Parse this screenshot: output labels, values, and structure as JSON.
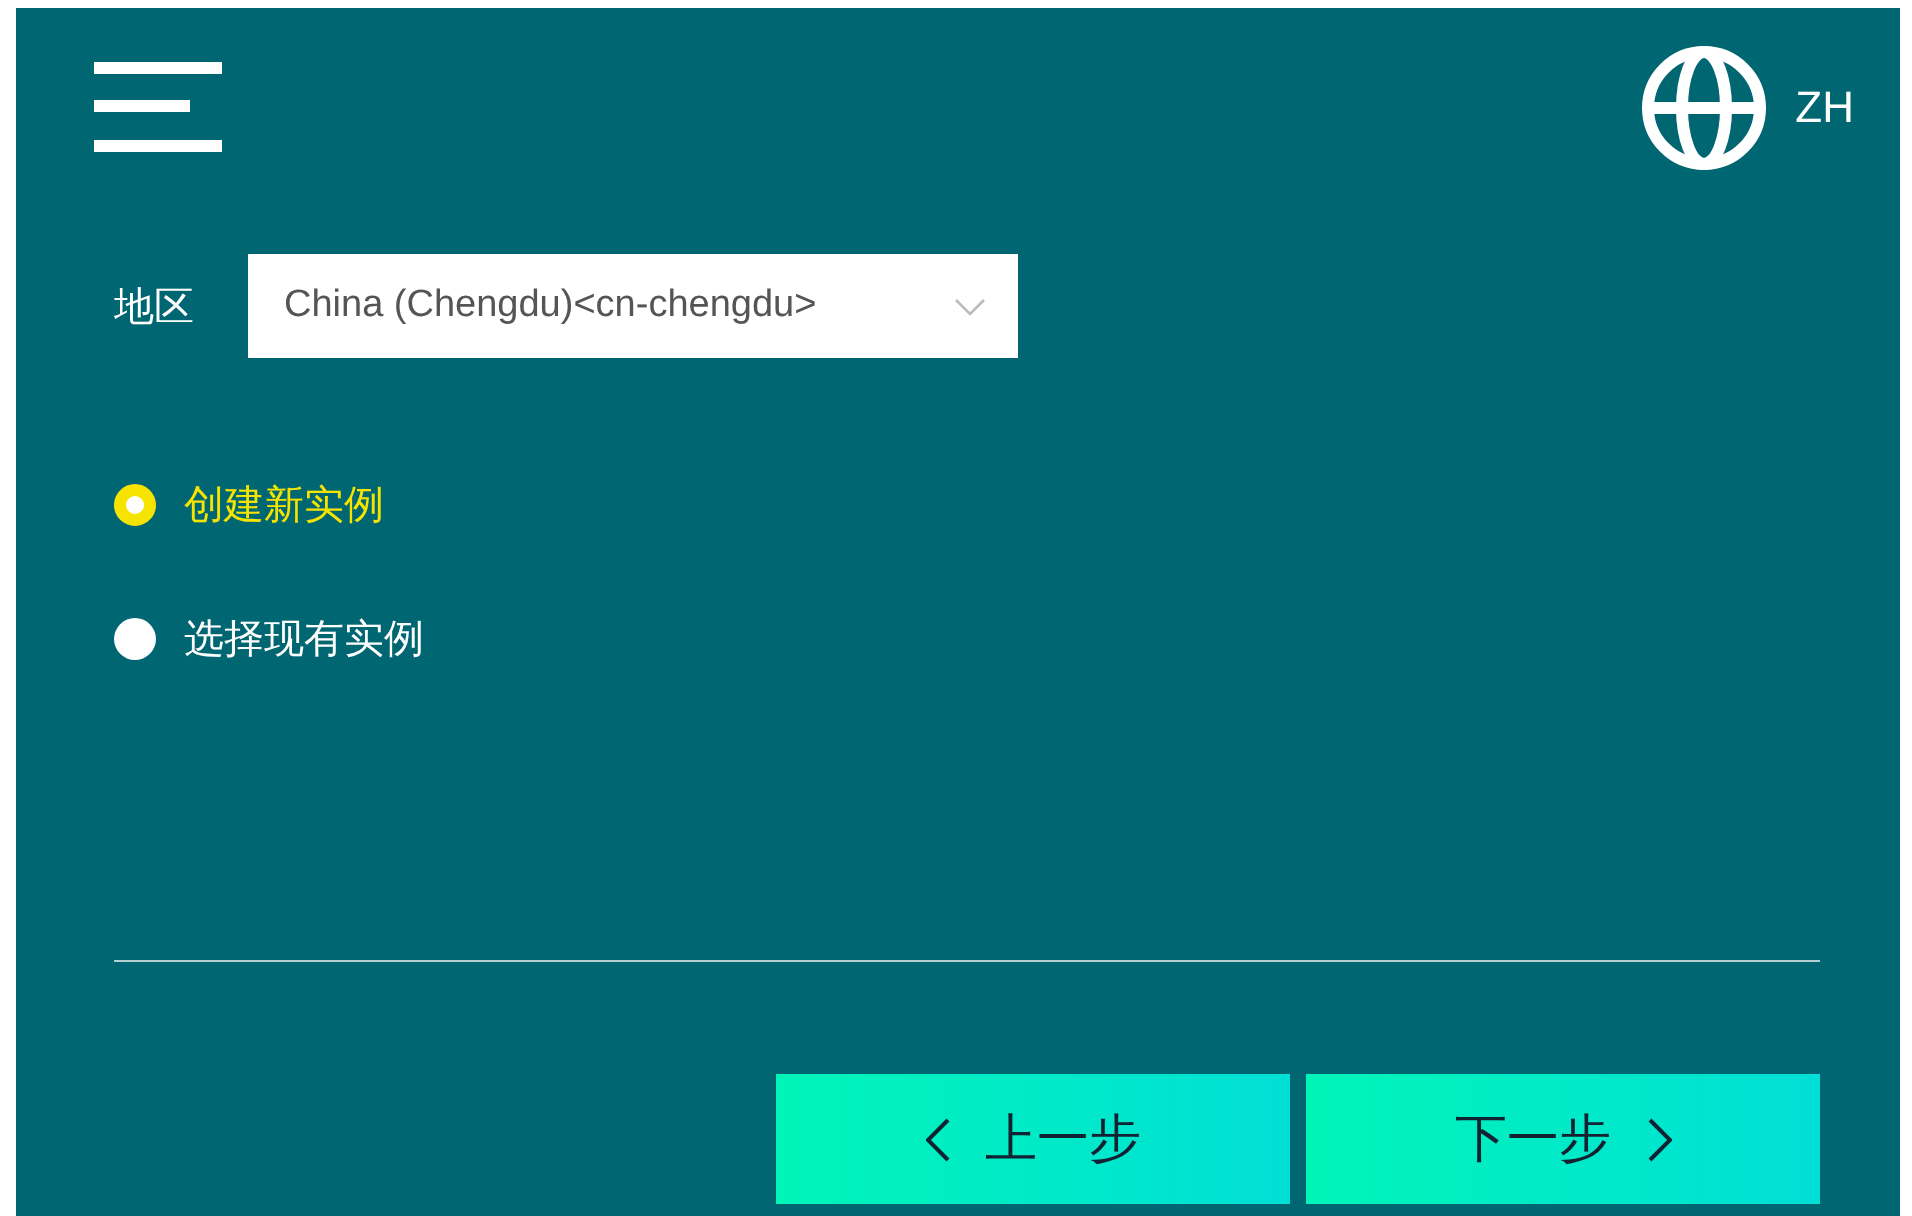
{
  "header": {
    "language": "ZH"
  },
  "region": {
    "label": "地区",
    "value": "China (Chengdu)<cn-chengdu>"
  },
  "options": [
    {
      "label": "创建新实例",
      "selected": true
    },
    {
      "label": "选择现有实例",
      "selected": false
    }
  ],
  "buttons": [
    {
      "label": "上一步",
      "kind": "back"
    },
    {
      "label": "下一步",
      "kind": "next"
    }
  ]
}
